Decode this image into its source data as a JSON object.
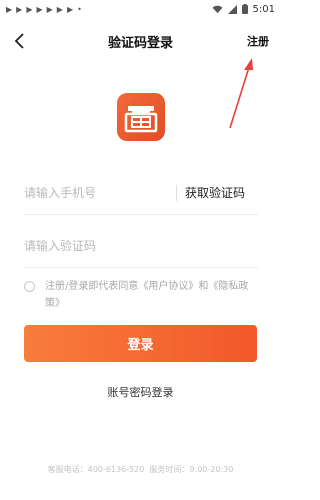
{
  "status_bar": {
    "time": "5:01",
    "notification_icons": [
      "play-icon",
      "play-icon",
      "play-icon",
      "play-icon",
      "play-icon",
      "play-icon",
      "play-icon",
      "dot-icon"
    ]
  },
  "header": {
    "title": "验证码登录",
    "register_label": "注册"
  },
  "form": {
    "phone_placeholder": "请输入手机号",
    "get_code_label": "获取验证码",
    "code_placeholder": "请输入验证码"
  },
  "agreement": {
    "prefix": "注册/登录即代表同意",
    "user_agreement": "《用户协议》",
    "conjunction": "和",
    "privacy_policy": "《隐私政策》"
  },
  "login_button": "登录",
  "password_login": "账号密码登录",
  "footer": {
    "phone_label": "客服电话：",
    "phone": "400-6136-520",
    "hours_label": "服务时间：",
    "hours": "9:00-20:30"
  },
  "colors": {
    "accent": "#f2582c",
    "annotation": "#e8413c"
  }
}
